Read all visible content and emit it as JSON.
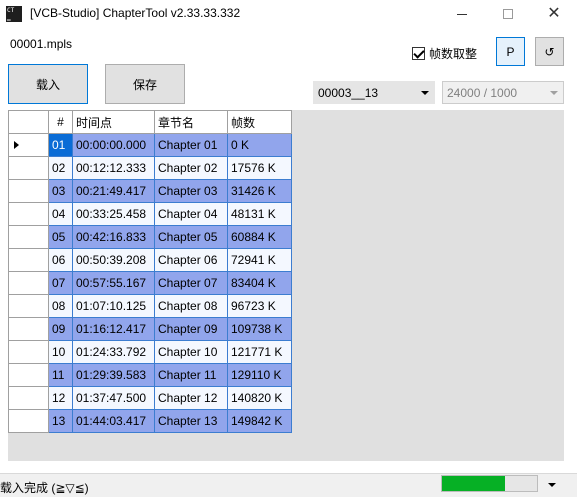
{
  "window": {
    "icon_text": "CT ▁",
    "title": "[VCB-Studio] ChapterTool v2.33.33.332"
  },
  "file": {
    "name": "00001.mpls"
  },
  "options": {
    "frame_round_label": "帧数取整",
    "frame_round_checked": true,
    "p_button": "P",
    "refresh_button": "↺"
  },
  "buttons": {
    "load": "载入",
    "save": "保存"
  },
  "selectors": {
    "chapter_source": "00003__13",
    "fps": "24000 / 1000"
  },
  "table": {
    "headers": {
      "num": "#",
      "time": "时间点",
      "name": "章节名",
      "frames": "帧数"
    },
    "rows": [
      {
        "num": "01",
        "time": "00:00:00.000",
        "name": "Chapter 01",
        "frames": "0 K"
      },
      {
        "num": "02",
        "time": "00:12:12.333",
        "name": "Chapter 02",
        "frames": "17576 K"
      },
      {
        "num": "03",
        "time": "00:21:49.417",
        "name": "Chapter 03",
        "frames": "31426 K"
      },
      {
        "num": "04",
        "time": "00:33:25.458",
        "name": "Chapter 04",
        "frames": "48131 K"
      },
      {
        "num": "05",
        "time": "00:42:16.833",
        "name": "Chapter 05",
        "frames": "60884 K"
      },
      {
        "num": "06",
        "time": "00:50:39.208",
        "name": "Chapter 06",
        "frames": "72941 K"
      },
      {
        "num": "07",
        "time": "00:57:55.167",
        "name": "Chapter 07",
        "frames": "83404 K"
      },
      {
        "num": "08",
        "time": "01:07:10.125",
        "name": "Chapter 08",
        "frames": "96723 K"
      },
      {
        "num": "09",
        "time": "01:16:12.417",
        "name": "Chapter 09",
        "frames": "109738 K"
      },
      {
        "num": "10",
        "time": "01:24:33.792",
        "name": "Chapter 10",
        "frames": "121771 K"
      },
      {
        "num": "11",
        "time": "01:29:39.583",
        "name": "Chapter 11",
        "frames": "129110 K"
      },
      {
        "num": "12",
        "time": "01:37:47.500",
        "name": "Chapter 12",
        "frames": "140820 K"
      },
      {
        "num": "13",
        "time": "01:44:03.417",
        "name": "Chapter 13",
        "frames": "149842 K"
      }
    ]
  },
  "status": {
    "text": "载入完成 (≧▽≦)",
    "progress": 0.66
  },
  "colors": {
    "row_alt": "#91a5ec",
    "row_norm": "#f4f8ff",
    "selected": "#0a6cd6",
    "progress_fill": "#06b025"
  }
}
